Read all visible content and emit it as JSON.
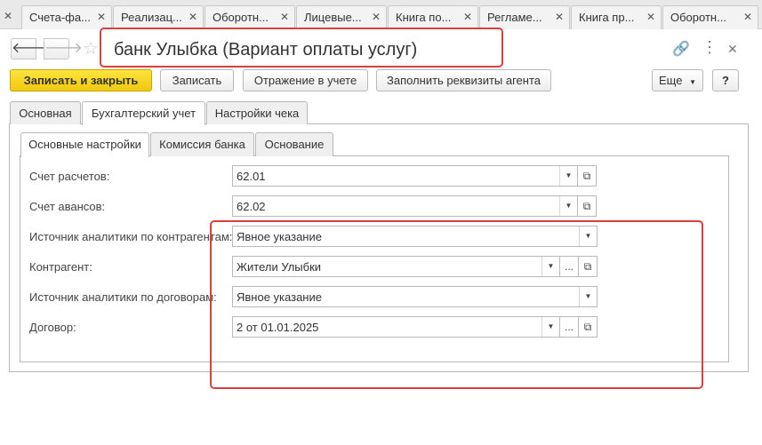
{
  "window_tabs": [
    {
      "label": "Счета-фа..."
    },
    {
      "label": "Реализац..."
    },
    {
      "label": "Оборотн..."
    },
    {
      "label": "Лицевые..."
    },
    {
      "label": "Книга по..."
    },
    {
      "label": "Регламе..."
    },
    {
      "label": "Книга пр..."
    },
    {
      "label": "Оборотн..."
    }
  ],
  "title": "банк Улыбка (Вариант оплаты услуг)",
  "toolbar": {
    "save_close": "Записать и закрыть",
    "save": "Записать",
    "accounting": "Отражение в учете",
    "fill_agent": "Заполнить реквизиты агента",
    "more": "Еще",
    "help": "?"
  },
  "main_tabs": [
    "Основная",
    "Бухгалтерский учет",
    "Настройки чека"
  ],
  "sub_tabs": [
    "Основные настройки",
    "Комиссия банка",
    "Основание"
  ],
  "form": {
    "account_label": "Счет расчетов:",
    "account_value": "62.01",
    "advance_label": "Счет авансов:",
    "advance_value": "62.02",
    "cp_source_label": "Источник аналитики по контрагентам:",
    "cp_source_value": "Явное указание",
    "counterparty_label": "Контрагент:",
    "counterparty_value": "Жители Улыбки",
    "contract_source_label": "Источник аналитики по договорам:",
    "contract_source_value": "Явное указание",
    "contract_label": "Договор:",
    "contract_value": "2 от 01.01.2025"
  },
  "colors": {
    "primary": "#f5cf1a",
    "highlight": "#d9403d"
  }
}
